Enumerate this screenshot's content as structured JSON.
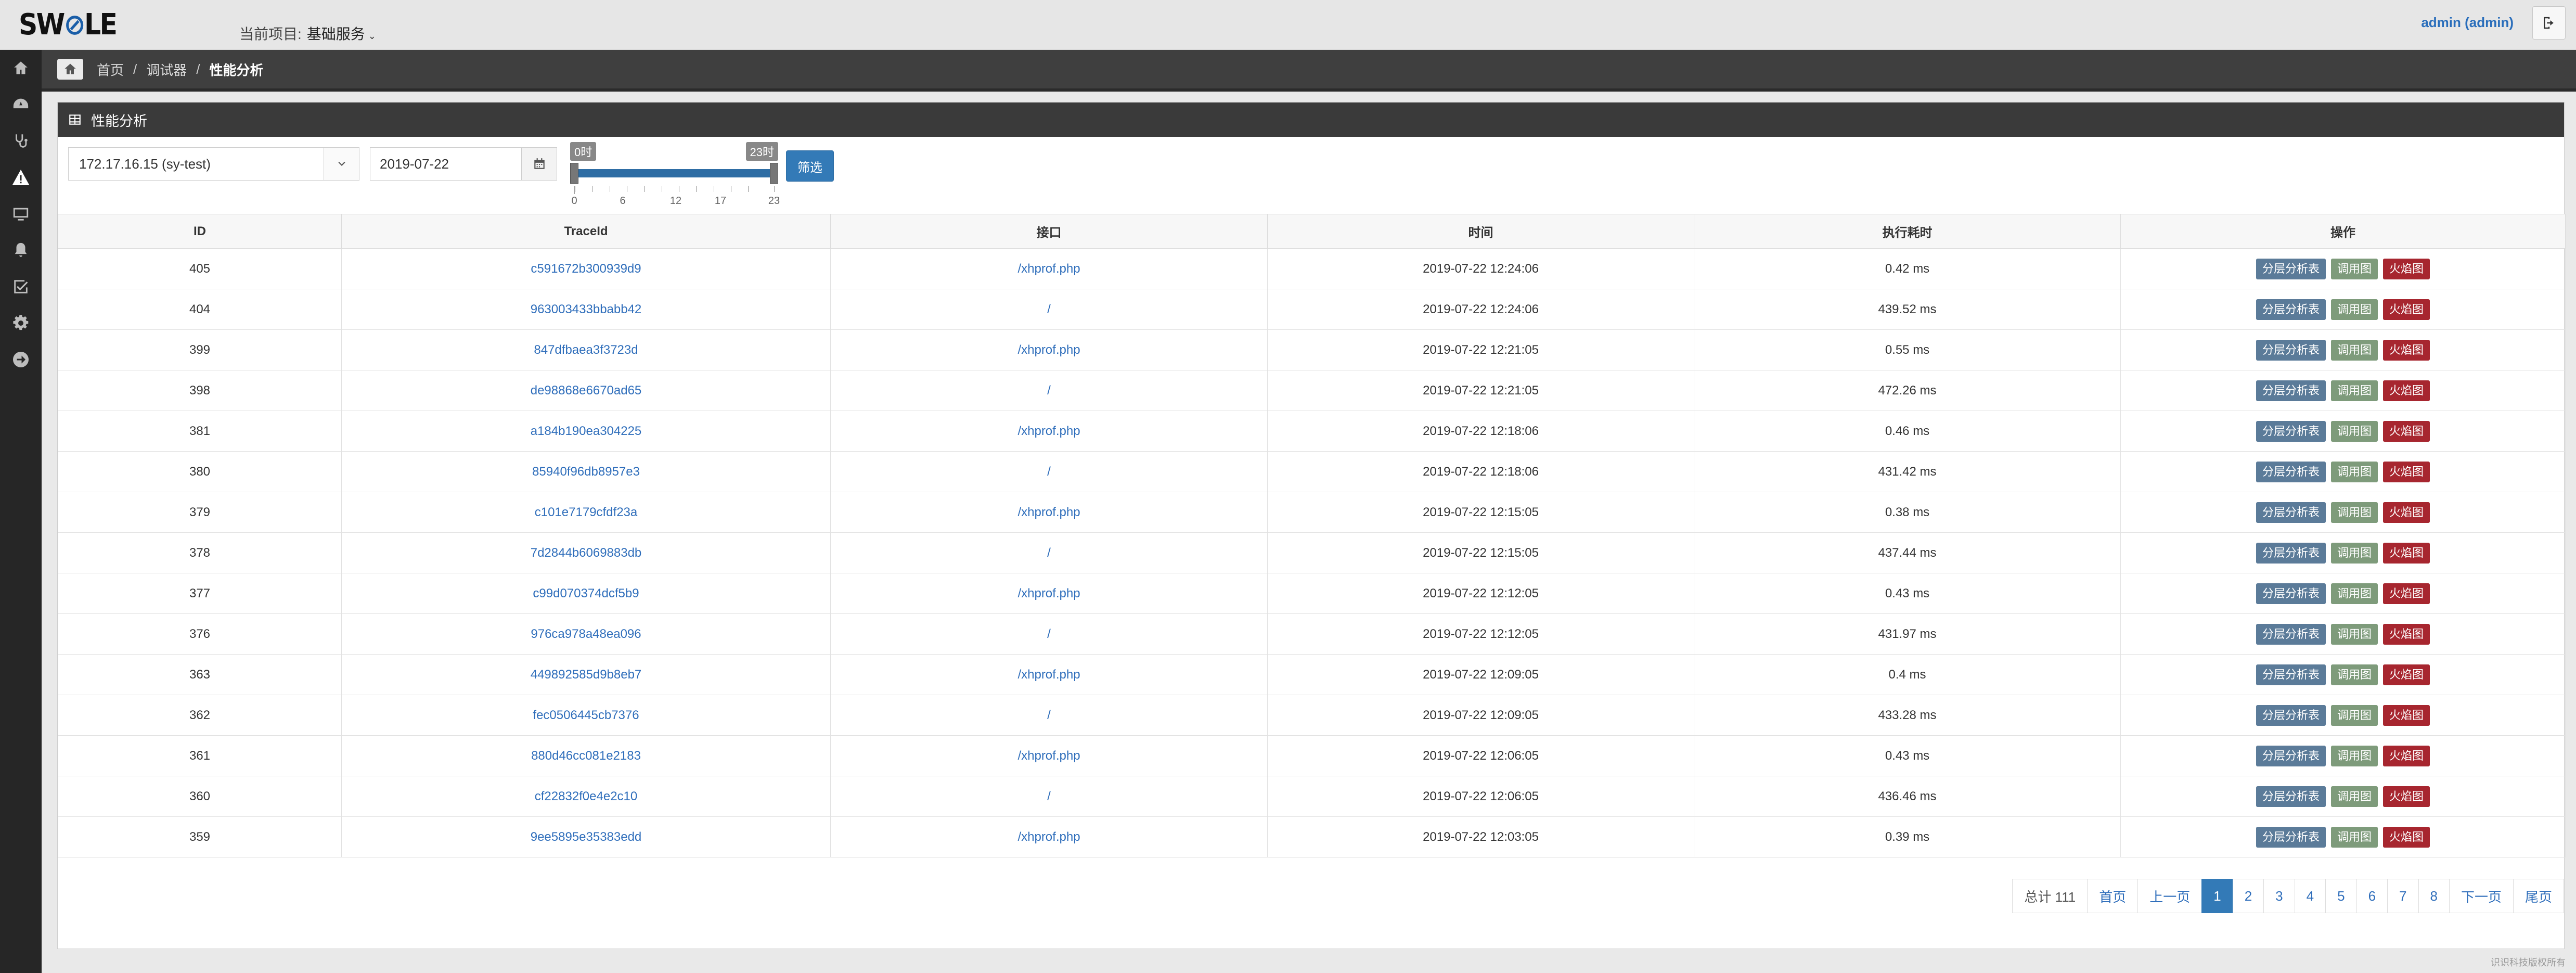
{
  "brand": {
    "logo": "SWOLE",
    "logo_mark": "O"
  },
  "header": {
    "project_label": "当前项目:",
    "project_name": "基础服务",
    "user": "admin (admin)"
  },
  "sidebar": {
    "icons": [
      "home-icon",
      "dashboard-icon",
      "stethoscope-icon",
      "warning-icon",
      "monitor-icon",
      "bell-icon",
      "checkbox-icon",
      "gear-icon",
      "arrow-right-icon"
    ]
  },
  "breadcrumb": {
    "items": [
      "首页",
      "调试器",
      "性能分析"
    ],
    "separator": "/"
  },
  "panel": {
    "title": "性能分析"
  },
  "filters": {
    "server": "172.17.16.15 (sy-test)",
    "date": "2019-07-22",
    "range_start_label": "0时",
    "range_end_label": "23时",
    "range": [
      0,
      23
    ],
    "tick_labels": [
      "0",
      "6",
      "12",
      "17",
      "23"
    ],
    "submit": "筛选"
  },
  "table": {
    "headers": [
      "ID",
      "TraceId",
      "接口",
      "时间",
      "执行耗时",
      "操作"
    ],
    "op_labels": [
      "分层分析表",
      "调用图",
      "火焰图"
    ],
    "rows": [
      {
        "id": "405",
        "trace": "c591672b300939d9",
        "api": "/xhprof.php",
        "time": "2019-07-22 12:24:06",
        "cost": "0.42 ms"
      },
      {
        "id": "404",
        "trace": "963003433bbabb42",
        "api": "/",
        "time": "2019-07-22 12:24:06",
        "cost": "439.52 ms"
      },
      {
        "id": "399",
        "trace": "847dfbaea3f3723d",
        "api": "/xhprof.php",
        "time": "2019-07-22 12:21:05",
        "cost": "0.55 ms"
      },
      {
        "id": "398",
        "trace": "de98868e6670ad65",
        "api": "/",
        "time": "2019-07-22 12:21:05",
        "cost": "472.26 ms"
      },
      {
        "id": "381",
        "trace": "a184b190ea304225",
        "api": "/xhprof.php",
        "time": "2019-07-22 12:18:06",
        "cost": "0.46 ms"
      },
      {
        "id": "380",
        "trace": "85940f96db8957e3",
        "api": "/",
        "time": "2019-07-22 12:18:06",
        "cost": "431.42 ms"
      },
      {
        "id": "379",
        "trace": "c101e7179cfdf23a",
        "api": "/xhprof.php",
        "time": "2019-07-22 12:15:05",
        "cost": "0.38 ms"
      },
      {
        "id": "378",
        "trace": "7d2844b6069883db",
        "api": "/",
        "time": "2019-07-22 12:15:05",
        "cost": "437.44 ms"
      },
      {
        "id": "377",
        "trace": "c99d070374dcf5b9",
        "api": "/xhprof.php",
        "time": "2019-07-22 12:12:05",
        "cost": "0.43 ms"
      },
      {
        "id": "376",
        "trace": "976ca978a48ea096",
        "api": "/",
        "time": "2019-07-22 12:12:05",
        "cost": "431.97 ms"
      },
      {
        "id": "363",
        "trace": "449892585d9b8eb7",
        "api": "/xhprof.php",
        "time": "2019-07-22 12:09:05",
        "cost": "0.4 ms"
      },
      {
        "id": "362",
        "trace": "fec0506445cb7376",
        "api": "/",
        "time": "2019-07-22 12:09:05",
        "cost": "433.28 ms"
      },
      {
        "id": "361",
        "trace": "880d46cc081e2183",
        "api": "/xhprof.php",
        "time": "2019-07-22 12:06:05",
        "cost": "0.43 ms"
      },
      {
        "id": "360",
        "trace": "cf22832f0e4e2c10",
        "api": "/",
        "time": "2019-07-22 12:06:05",
        "cost": "436.46 ms"
      },
      {
        "id": "359",
        "trace": "9ee5895e35383edd",
        "api": "/xhprof.php",
        "time": "2019-07-22 12:03:05",
        "cost": "0.39 ms"
      }
    ]
  },
  "pagination": {
    "total": "总计 111",
    "first": "首页",
    "prev": "上一页",
    "pages": [
      "1",
      "2",
      "3",
      "4",
      "5",
      "6",
      "7",
      "8"
    ],
    "active": "1",
    "next": "下一页",
    "last": "尾页"
  },
  "footer": {
    "text": "识识科技版权所有"
  },
  "colors": {
    "accent": "#337ab7",
    "sidebar": "#262626",
    "danger": "#a7262f"
  }
}
